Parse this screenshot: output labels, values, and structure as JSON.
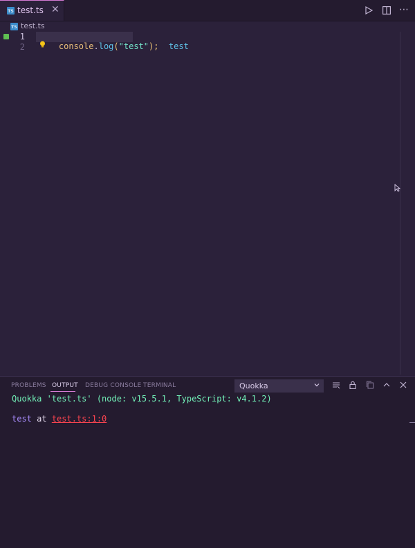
{
  "tab": {
    "label": "test.ts",
    "icon": "typescript-file-icon",
    "icon_text": "TS"
  },
  "toolbar": {
    "run": "run-icon",
    "split": "split-editor-icon",
    "more": "⋯"
  },
  "breadcrumb": {
    "file": "test.ts",
    "icon_text": "TS"
  },
  "editor": {
    "line_numbers": [
      "1",
      "2"
    ],
    "line1": {
      "obj": "console",
      "dot": ".",
      "fn": "log",
      "open": "(",
      "str": "\"test\"",
      "close": ");",
      "inline_value": "test"
    }
  },
  "panel": {
    "tabs": [
      "PROBLEMS",
      "OUTPUT",
      "DEBUG CONSOLE",
      "TERMINAL"
    ],
    "active_tab": "OUTPUT",
    "channel": "Quokka",
    "output": {
      "header": "Quokka 'test.ts' (node: v15.5.1, TypeScript: v4.1.2)",
      "value": "test",
      "at": " at ",
      "link": "test.ts:1:0"
    }
  },
  "colors": {
    "accent": "#d57bd4",
    "background": "#2b213a",
    "panel": "#241b2f"
  }
}
